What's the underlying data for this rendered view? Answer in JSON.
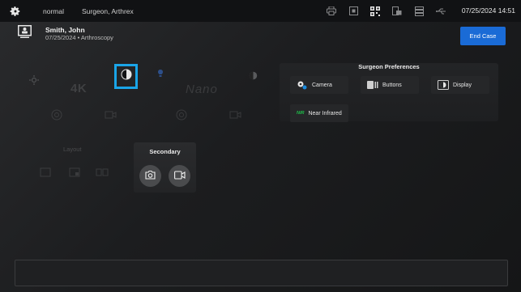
{
  "topbar": {
    "mode": "normal",
    "surgeon": "Surgeon, Arthrex",
    "datetime": "07/25/2024 14:51",
    "status_icons": [
      "printer-icon",
      "record-icon",
      "qr-code-icon",
      "export-icon",
      "storage-icon",
      "usb-icon"
    ]
  },
  "patient": {
    "name": "Smith, John",
    "details": "07/25/2024 • Arthroscopy"
  },
  "actions": {
    "end_case": "End Case"
  },
  "cameras": {
    "left_label": "4K",
    "right_label": "Nano"
  },
  "layout": {
    "label": "Layout"
  },
  "secondary": {
    "title": "Secondary"
  },
  "preferences": {
    "title": "Surgeon Preferences",
    "items": [
      {
        "label": "Camera",
        "icon": "camera-pref-icon"
      },
      {
        "label": "Buttons",
        "icon": "buttons-pref-icon"
      },
      {
        "label": "Display",
        "icon": "display-pref-icon"
      },
      {
        "label": "Near Infrared",
        "icon": "nir-pref-icon",
        "badge": "NIR"
      }
    ]
  },
  "colors": {
    "accent": "#1a6bd6",
    "selection": "#1aa5e8",
    "topbar": "#111214"
  }
}
